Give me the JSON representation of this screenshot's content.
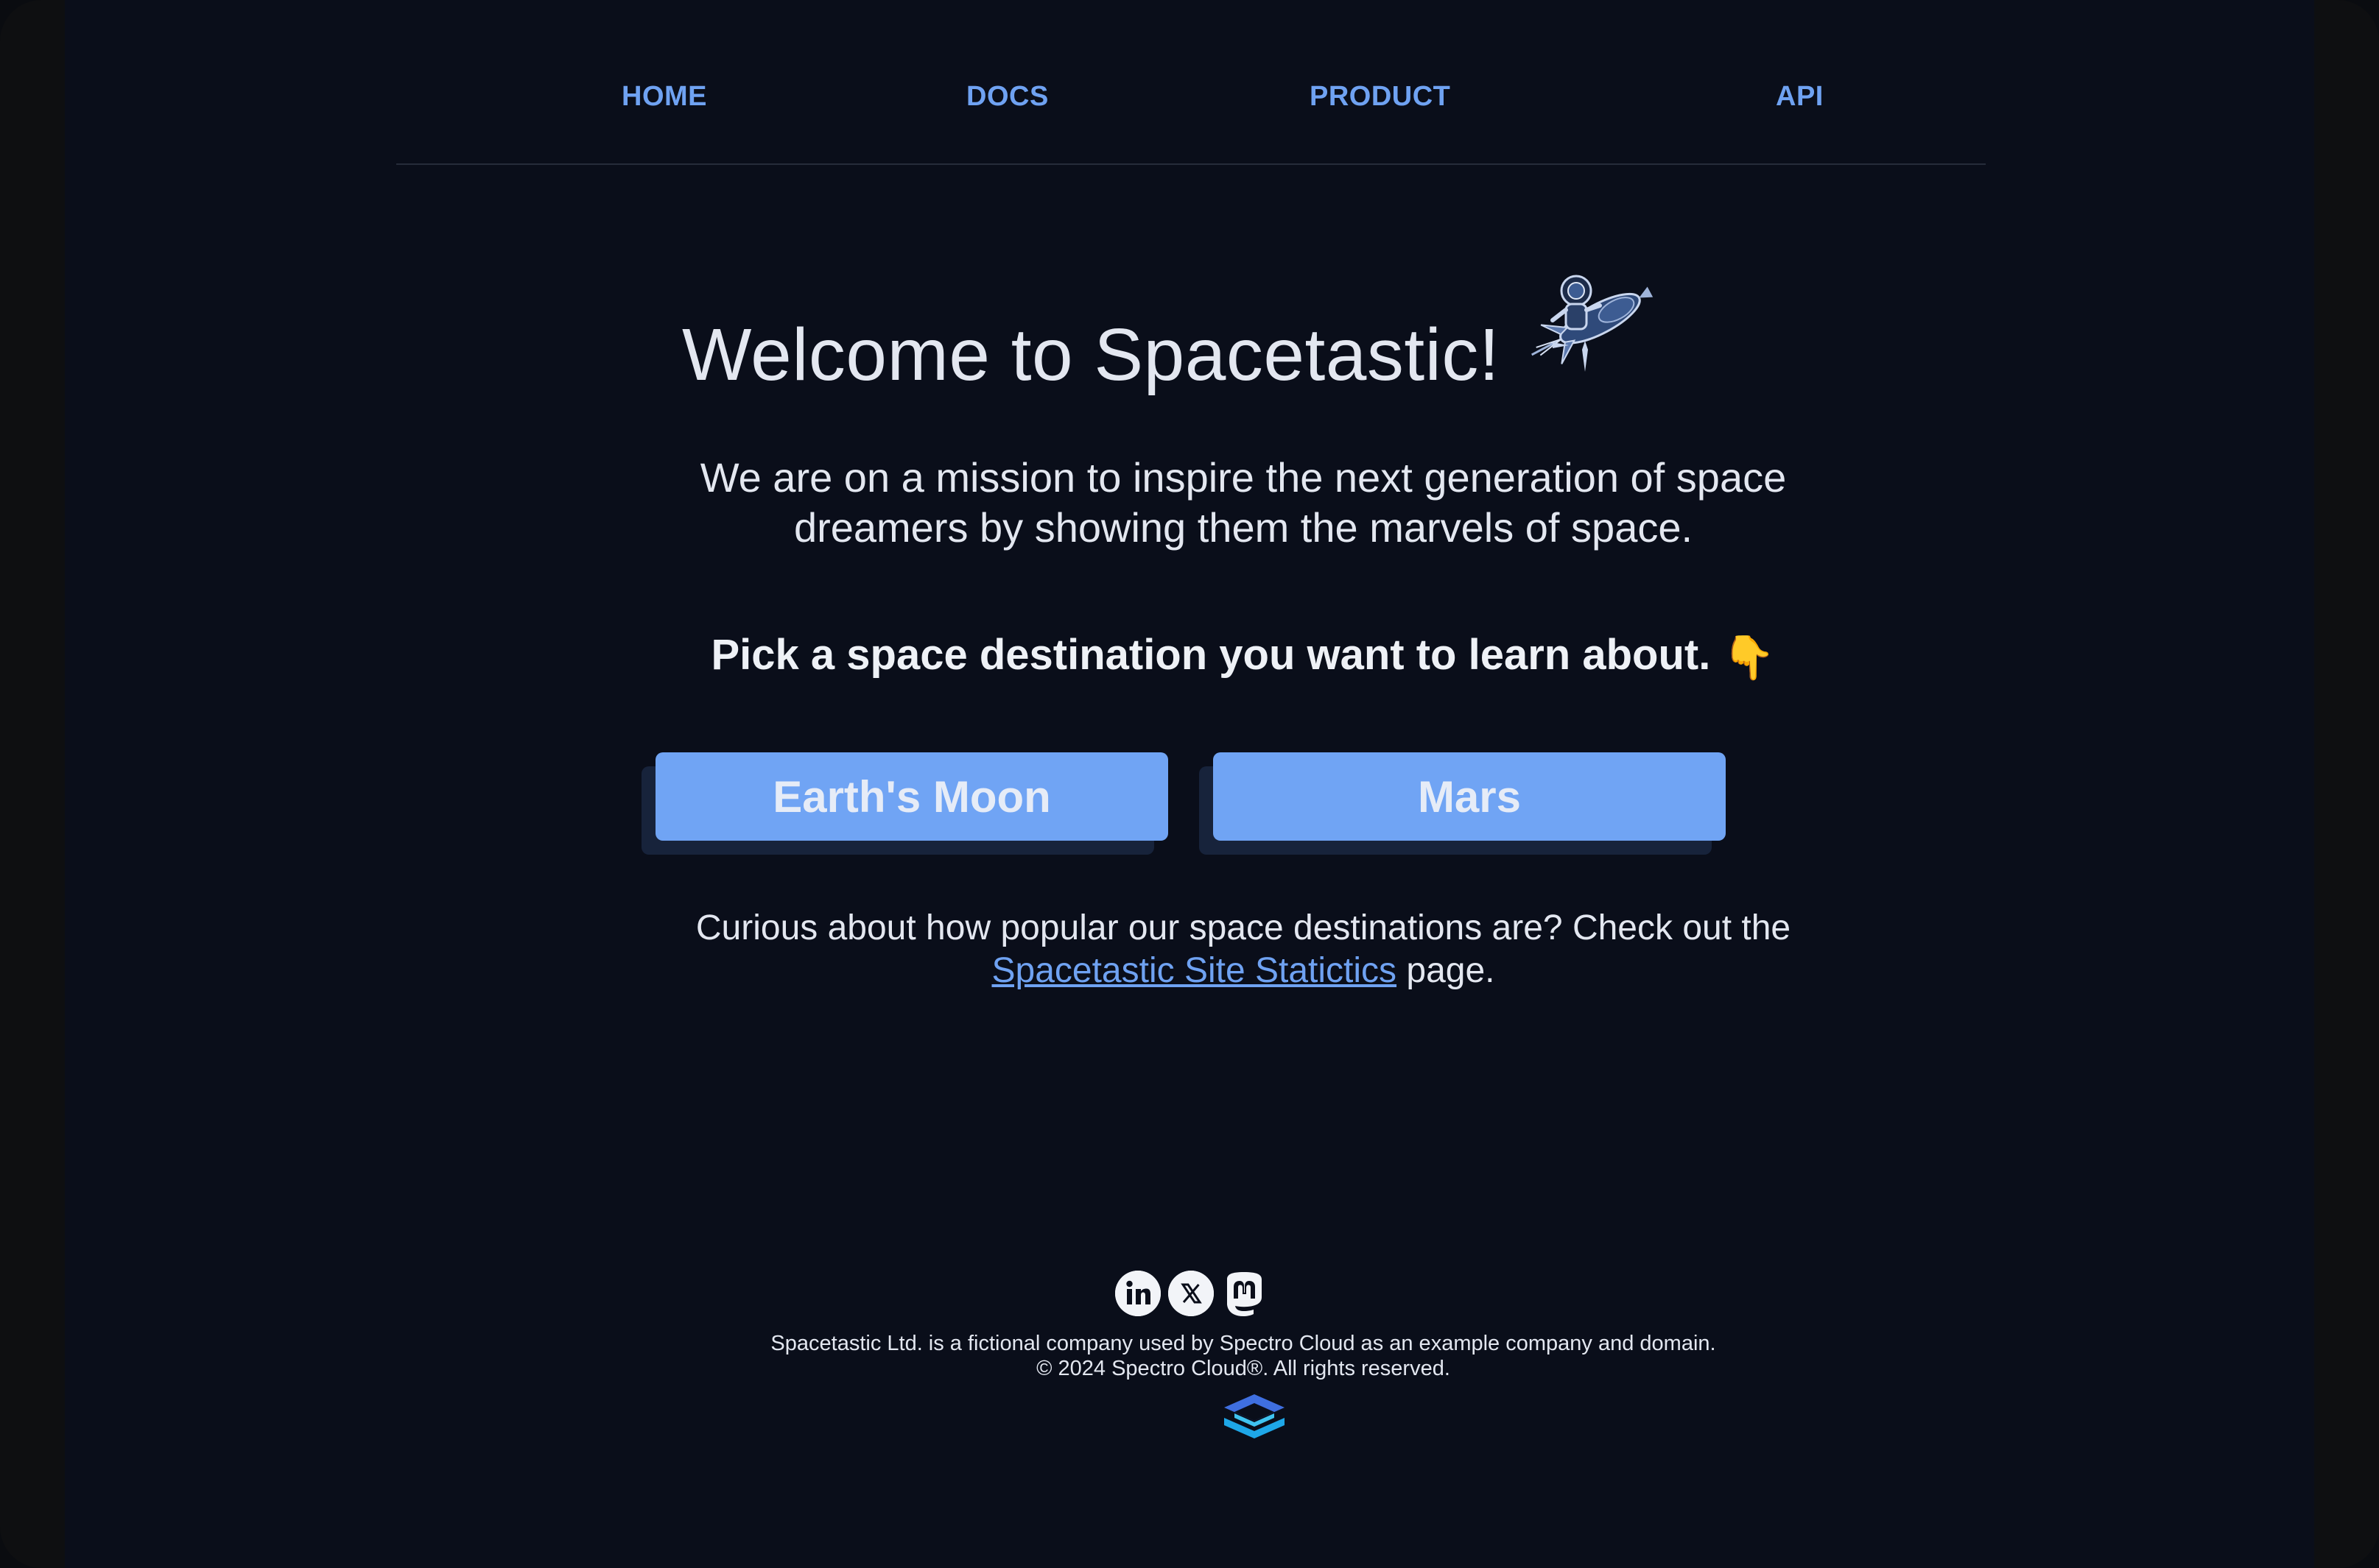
{
  "nav": {
    "items": [
      {
        "label": "HOME"
      },
      {
        "label": "DOCS"
      },
      {
        "label": "PRODUCT"
      },
      {
        "label": "API"
      }
    ]
  },
  "hero": {
    "title": "Welcome to Spacetastic!",
    "mission": "We are on a mission to inspire the next generation of space dreamers by showing them the marvels of space.",
    "pick_prompt": "Pick a space destination you want to learn about.",
    "pick_emoji": "👇"
  },
  "destinations": [
    {
      "label": "Earth's Moon"
    },
    {
      "label": "Mars"
    }
  ],
  "stats": {
    "text_before": "Curious about how popular our space destinations are? Check out the",
    "link_text": " Spacetastic Site Statictics",
    "text_after": " page."
  },
  "footer": {
    "social_icons": [
      "linkedin-icon",
      "x-icon",
      "mastodon-icon"
    ],
    "disclaimer": "Spacetastic Ltd. is a fictional company used by Spectro Cloud as an example company and domain.",
    "copyright": "© 2024 Spectro Cloud®. All rights reserved."
  },
  "colors": {
    "background": "#0a0e1a",
    "accent": "#70a4f4",
    "nav_link": "#6fa2f2",
    "text": "#e3e7f0"
  }
}
